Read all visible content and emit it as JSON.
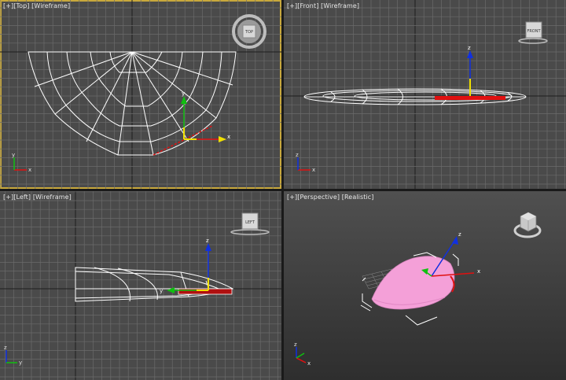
{
  "viewports": [
    {
      "id": "top",
      "bracket": "[+]",
      "view": "[Top]",
      "shading": "[Wireframe]",
      "cube_label": "TOP",
      "active": true
    },
    {
      "id": "front",
      "bracket": "[+]",
      "view": "[Front]",
      "shading": "[Wireframe]",
      "cube_label": "FRONT",
      "active": false
    },
    {
      "id": "left",
      "bracket": "[+]",
      "view": "[Left]",
      "shading": "[Wireframe]",
      "cube_label": "LEFT",
      "active": false
    },
    {
      "id": "perspective",
      "bracket": "[+]",
      "view": "[Perspective]",
      "shading": "[Realistic]",
      "cube_label": "",
      "active": false
    }
  ],
  "axes": {
    "x": "x",
    "y": "y",
    "z": "z"
  },
  "colors": {
    "grid_bg": "#4a4a4a",
    "grid_line": "#6b6b6b",
    "grid_axis": "#1e1e1e",
    "wire": "#ffffff",
    "x_axis": "#e01010",
    "y_axis": "#10c010",
    "z_axis": "#1030e0",
    "gizmo_yellow": "#f0e000",
    "active_border": "#c8a83c",
    "mesh_pink": "#f4a0d8"
  }
}
